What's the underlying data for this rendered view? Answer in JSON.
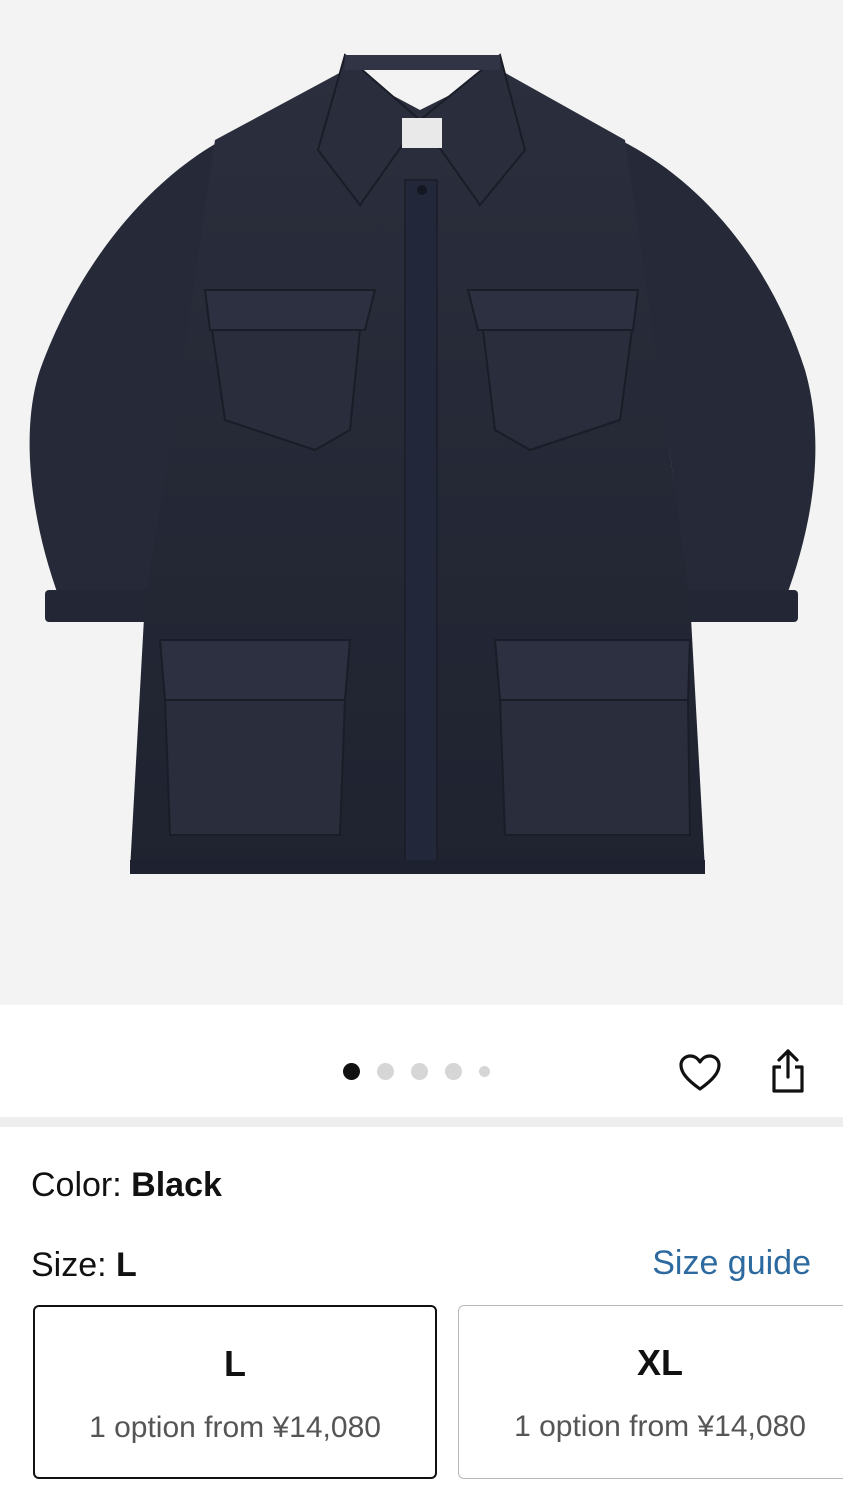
{
  "product": {
    "image_alt": "Black field jacket with four flap pockets",
    "gallery": {
      "total_images": 5,
      "active_index": 0
    }
  },
  "icons": {
    "favorite": "heart-icon",
    "share": "share-icon"
  },
  "color": {
    "label": "Color:",
    "value": "Black"
  },
  "size": {
    "label": "Size:",
    "value": "L",
    "guide_label": "Size guide",
    "options": [
      {
        "size": "L",
        "detail": "1 option from ¥14,080",
        "selected": true
      },
      {
        "size": "XL",
        "detail": "1 option from ¥14,080",
        "selected": false
      }
    ]
  },
  "colors": {
    "link": "#2c6aa0",
    "text": "#111111",
    "selected_border": "#111111",
    "unselected_border": "#b9b9b9"
  }
}
